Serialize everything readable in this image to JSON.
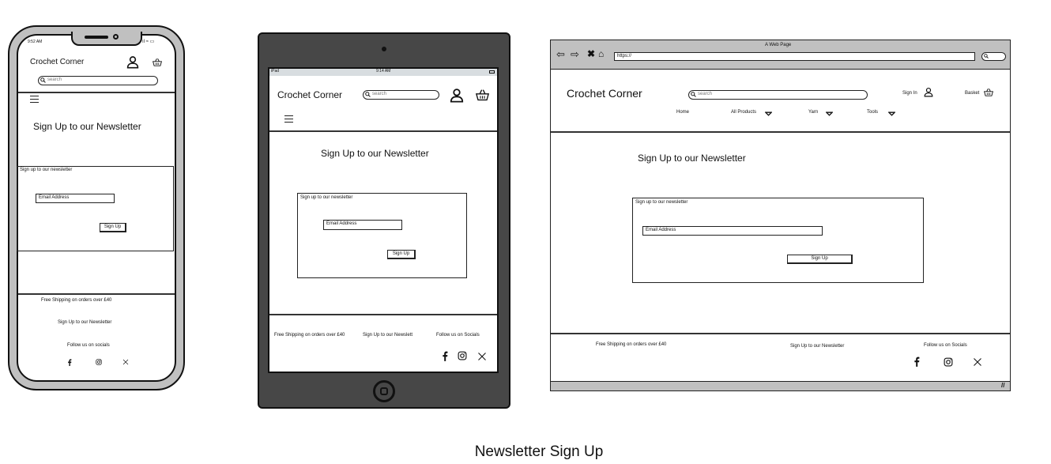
{
  "caption": "Newsletter Sign Up",
  "brand": "Crochet Corner",
  "search_placeholder": "search",
  "heading": "Sign Up to our Newsletter",
  "form_label": "Sign up to our newsletter",
  "email_placeholder": "Email Address",
  "submit_label": "Sign Up",
  "mobile": {
    "time": "9:52 AM",
    "footer": {
      "shipping": "Free Shipping on orders over £40",
      "newsletter": "Sign Up to our Newsletter",
      "socials": "Follow us on socials"
    }
  },
  "tablet": {
    "carrier": "iPad",
    "time": "9:14 AM",
    "footer": {
      "shipping": "Free Shipping on orders over £40",
      "newsletter": "Sign Up to our Newslett",
      "socials": "Follow us on Socials"
    }
  },
  "desktop": {
    "window_title": "A Web Page",
    "url": "https://",
    "sign_in": "Sign In",
    "basket": "Basket",
    "nav": [
      {
        "label": "Home"
      },
      {
        "label": "All Products"
      },
      {
        "label": "Yarn"
      },
      {
        "label": "Tools"
      }
    ],
    "footer": {
      "shipping": "Free Shipping on orders over £40",
      "newsletter": "Sign Up to our Newsletter",
      "socials": "Follow us on Socials"
    }
  },
  "icons": [
    "user-icon",
    "basket-icon",
    "search-icon",
    "menu-icon",
    "facebook-icon",
    "instagram-icon",
    "x-icon"
  ],
  "colors": {
    "frame": "#c0c0c0",
    "tablet": "#474747",
    "statusbar": "#d8dde0"
  }
}
